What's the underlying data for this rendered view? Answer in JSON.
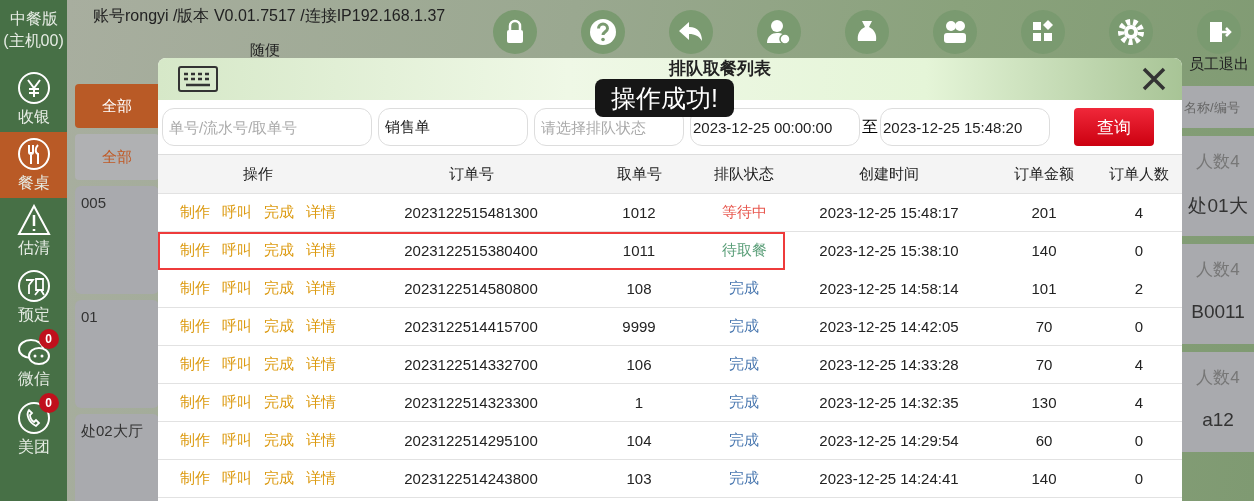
{
  "status_line": {
    "account": "账号rongyi /版本 V0.01.7517 /连接IP192.168.1.37",
    "mode": "随便"
  },
  "sidebar": {
    "title": "中餐版\n(主机00)",
    "items": [
      {
        "label": "收银",
        "selected": false
      },
      {
        "label": "餐桌",
        "selected": true
      },
      {
        "label": "估清",
        "selected": false
      },
      {
        "label": "预定",
        "selected": false
      },
      {
        "label": "微信",
        "selected": false,
        "badge": "0"
      },
      {
        "label": "美团",
        "selected": false,
        "badge": "0"
      }
    ]
  },
  "toolbar": {
    "exit": {
      "label": "员工退出"
    }
  },
  "left_panel": {
    "filter_button": "全部",
    "filter_tab": "全部",
    "tables": [
      {
        "name": "005"
      },
      {
        "name": "01"
      },
      {
        "name": "处02大厅"
      }
    ]
  },
  "right_panel": {
    "search": {
      "placeholder": "名称/编号"
    },
    "tables": [
      {
        "guests": "人数4",
        "name": "处01大"
      },
      {
        "guests": "人数4",
        "name": "B0011"
      },
      {
        "guests": "人数4",
        "name": "a12"
      }
    ]
  },
  "dialog": {
    "title": "排队取餐列表",
    "filters": {
      "order_no": {
        "placeholder": "单号/流水号/取单号"
      },
      "type": {
        "value": "销售单"
      },
      "status": {
        "placeholder": "请选择排队状态"
      },
      "start": {
        "value": "2023-12-25 00:00:00"
      },
      "range_sep": "至",
      "end": {
        "value": "2023-12-25 15:48:20"
      },
      "query_button": "查询"
    },
    "table": {
      "columns": [
        "操作",
        "订单号",
        "取单号",
        "排队状态",
        "创建时间",
        "订单金额",
        "订单人数"
      ],
      "rows": [
        {
          "actions": [
            "制作",
            "呼叫",
            "完成",
            "详情"
          ],
          "order": "2023122515481300",
          "pickup": "1012",
          "status": "等待中",
          "kind": "waiting",
          "time": "2023-12-25 15:48:17",
          "amount": "201",
          "people": "4",
          "highlighted": false
        },
        {
          "actions": [
            "制作",
            "呼叫",
            "完成",
            "详情"
          ],
          "order": "2023122515380400",
          "pickup": "1011",
          "status": "待取餐",
          "kind": "ready",
          "time": "2023-12-25 15:38:10",
          "amount": "140",
          "people": "0",
          "highlighted": true
        },
        {
          "actions": [
            "制作",
            "呼叫",
            "完成",
            "详情"
          ],
          "order": "2023122514580800",
          "pickup": "108",
          "status": "完成",
          "kind": "done",
          "time": "2023-12-25 14:58:14",
          "amount": "101",
          "people": "2",
          "highlighted": false
        },
        {
          "actions": [
            "制作",
            "呼叫",
            "完成",
            "详情"
          ],
          "order": "2023122514415700",
          "pickup": "9999",
          "status": "完成",
          "kind": "done",
          "time": "2023-12-25 14:42:05",
          "amount": "70",
          "people": "0",
          "highlighted": false
        },
        {
          "actions": [
            "制作",
            "呼叫",
            "完成",
            "详情"
          ],
          "order": "2023122514332700",
          "pickup": "106",
          "status": "完成",
          "kind": "done",
          "time": "2023-12-25 14:33:28",
          "amount": "70",
          "people": "4",
          "highlighted": false
        },
        {
          "actions": [
            "制作",
            "呼叫",
            "完成",
            "详情"
          ],
          "order": "2023122514323300",
          "pickup": "1",
          "status": "完成",
          "kind": "done",
          "time": "2023-12-25 14:32:35",
          "amount": "130",
          "people": "4",
          "highlighted": false
        },
        {
          "actions": [
            "制作",
            "呼叫",
            "完成",
            "详情"
          ],
          "order": "2023122514295100",
          "pickup": "104",
          "status": "完成",
          "kind": "done",
          "time": "2023-12-25 14:29:54",
          "amount": "60",
          "people": "0",
          "highlighted": false
        },
        {
          "actions": [
            "制作",
            "呼叫",
            "完成",
            "详情"
          ],
          "order": "2023122514243800",
          "pickup": "103",
          "status": "完成",
          "kind": "done",
          "time": "2023-12-25 14:24:41",
          "amount": "140",
          "people": "0",
          "highlighted": false
        }
      ]
    }
  },
  "toast": "操作成功!"
}
